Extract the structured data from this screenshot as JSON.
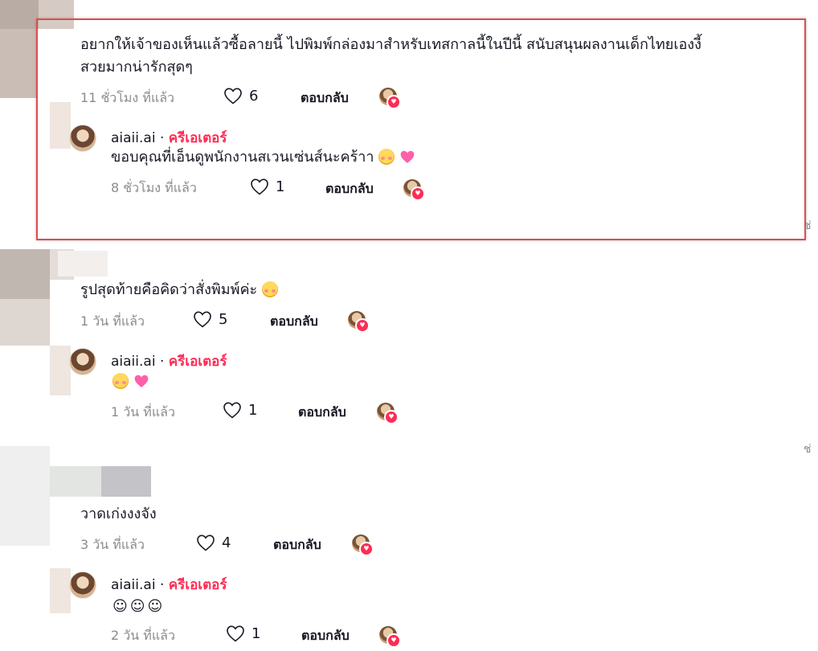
{
  "comments": [
    {
      "text_line1": "อยากให้เจ้าของเห็นแล้วซื้อลายนี้ ไปพิมพ์กล่องมาสำหรับเทสกาลนี้ในปีนี้ สนับสนุนผลงานเด็กไทยเองงี้",
      "text_line2": "สวยมากน่ารักสุดๆ",
      "time": "11 ชั่วโมง ที่แล้ว",
      "likes": "6",
      "reply_label": "ตอบกลับ",
      "reply": {
        "username": "aiaii.ai",
        "separator": " · ",
        "badge": "ครีเอเตอร์",
        "text": "ขอบคุณที่เอ็นดูพนักงานสเวนเซ่นส์นะคร้าา",
        "time": "8 ชั่วโมง ที่แล้ว",
        "likes": "1",
        "reply_label": "ตอบกลับ"
      }
    },
    {
      "text": "รูปสุดท้ายคือคิดว่าสั่งพิมพ์ค่ะ",
      "time": "1 วัน ที่แล้ว",
      "likes": "5",
      "reply_label": "ตอบกลับ",
      "reply": {
        "username": "aiaii.ai",
        "separator": " · ",
        "badge": "ครีเอเตอร์",
        "time": "1 วัน ที่แล้ว",
        "likes": "1",
        "reply_label": "ตอบกลับ"
      }
    },
    {
      "text": "วาดเก่งงงจัง",
      "time": "3 วัน ที่แล้ว",
      "likes": "4",
      "reply_label": "ตอบกลับ",
      "reply": {
        "username": "aiaii.ai",
        "separator": " · ",
        "badge": "ครีเอเตอร์",
        "text": "☺☺☺",
        "time": "2 วัน ที่แล้ว",
        "likes": "1",
        "reply_label": "ตอบกลับ"
      }
    }
  ],
  "side_truncated": [
    "ช่",
    "ช่"
  ],
  "colors": {
    "creator_badge": "#fe2c55",
    "highlight": "#e34b4b",
    "meta_text": "#8a8b91"
  }
}
